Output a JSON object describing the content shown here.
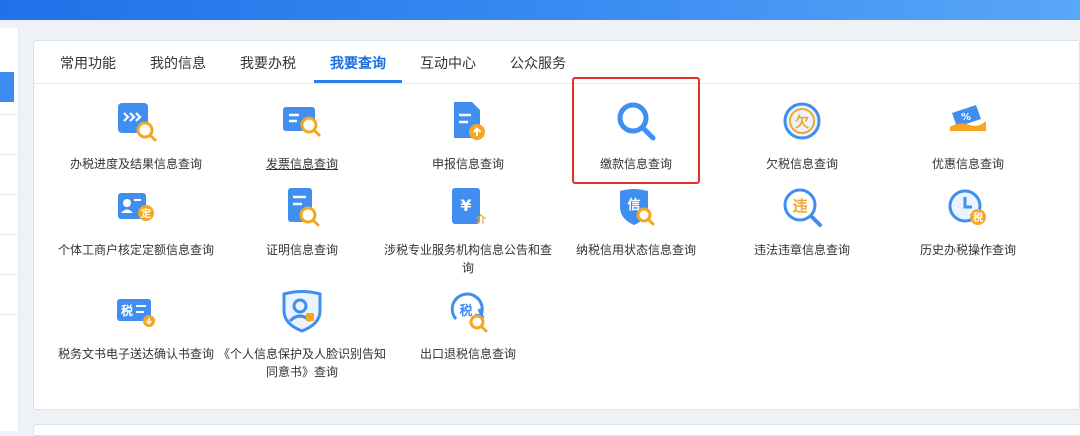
{
  "tabs": [
    {
      "label": "常用功能"
    },
    {
      "label": "我的信息"
    },
    {
      "label": "我要办税"
    },
    {
      "label": "我要查询",
      "active": true
    },
    {
      "label": "互动中心"
    },
    {
      "label": "公众服务"
    }
  ],
  "services": [
    {
      "label": "办税进度及结果信息查询",
      "icon": "progress-search-icon"
    },
    {
      "label": "发票信息查询",
      "icon": "invoice-search-icon"
    },
    {
      "label": "申报信息查询",
      "icon": "declaration-upload-icon"
    },
    {
      "label": "缴款信息查询",
      "icon": "magnifier-icon"
    },
    {
      "label": "欠税信息查询",
      "icon": "arrears-icon",
      "icon_text": "欠"
    },
    {
      "label": "优惠信息查询",
      "icon": "discount-ticket-icon",
      "icon_text": "%"
    },
    {
      "label": "个体工商户核定定额信息查询",
      "icon": "business-quota-icon",
      "icon_text": "定"
    },
    {
      "label": "证明信息查询",
      "icon": "certificate-search-icon"
    },
    {
      "label": "涉税专业服务机构信息公告和查询",
      "icon": "agency-icon",
      "icon_text": "¥",
      "icon_text2": "介"
    },
    {
      "label": "纳税信用状态信息查询",
      "icon": "credit-shield-icon",
      "icon_text": "信"
    },
    {
      "label": "违法违章信息查询",
      "icon": "violation-icon",
      "icon_text": "违"
    },
    {
      "label": "历史办税操作查询",
      "icon": "history-clock-icon",
      "icon_text": "税"
    },
    {
      "label": "税务文书电子送达确认书查询",
      "icon": "document-delivery-icon",
      "icon_text": "税"
    },
    {
      "label": "《个人信息保护及人脸识别告知同意书》查询",
      "icon": "privacy-face-icon"
    },
    {
      "label": "出口退税信息查询",
      "icon": "export-refund-icon",
      "icon_text": "税"
    }
  ],
  "colors": {
    "accent": "#1d6fe0",
    "icon_blue": "#3f8ef0",
    "icon_orange": "#f5a623",
    "highlight_red": "#e3302b"
  }
}
